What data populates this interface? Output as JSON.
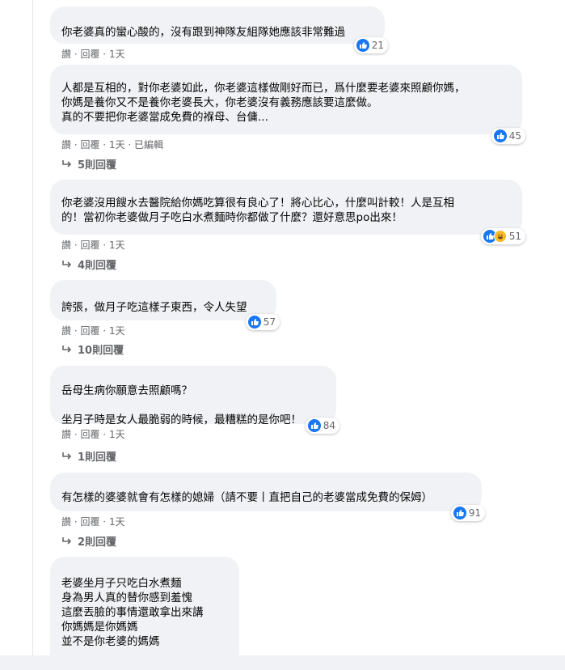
{
  "comments": [
    {
      "text": "你老婆真的蠻心酸的，沒有跟到神隊友組隊她應該非常難過",
      "likes": "21",
      "meta": {
        "like": "讚",
        "reply": "回覆",
        "time": "1天",
        "edited": ""
      }
    },
    {
      "text": "人都是互相的，對你老婆如此，你老婆這樣做剛好而已，爲什麼要老婆來照顧你媽，\n你媽是養你又不是養你老婆長大，你老婆沒有義務應該要這麼做。\n真的不要把你老婆當成免費的褓母、台傭...",
      "likes": "45",
      "meta": {
        "like": "讚",
        "reply": "回覆",
        "time": "1天",
        "edited": "已編輯"
      },
      "replies": "5則回覆"
    },
    {
      "text": "你老婆沒用餿水去醫院給你媽吃算很有良心了！將心比心，什麼叫計較！人是互相\n的！當初你老婆做月子吃白水煮麵時你都做了什麼？還好意思po出來！",
      "likes": "51",
      "meta": {
        "like": "讚",
        "reply": "回覆",
        "time": "1天",
        "edited": ""
      },
      "replies": "4則回覆"
    },
    {
      "text": "誇張，做月子吃這樣子東西，令人失望",
      "likes": "57",
      "meta": {
        "like": "讚",
        "reply": "回覆",
        "time": "1天",
        "edited": ""
      },
      "replies": "10則回覆"
    },
    {
      "text": "岳母生病你願意去照顧嗎？\n\n坐月子時是女人最脆弱的時候，最糟糕的是你吧！",
      "likes": "84",
      "meta": {
        "like": "讚",
        "reply": "回覆",
        "time": "1天",
        "edited": ""
      },
      "replies": "1則回覆"
    },
    {
      "text": "有怎樣的婆婆就會有怎樣的媳婦（請不要丨直把自己的老婆當成免費的保姆）",
      "likes": "91",
      "meta": {
        "like": "讚",
        "reply": "回覆",
        "time": "1天",
        "edited": ""
      },
      "replies": "2則回覆"
    },
    {
      "text": "老婆坐月子只吃白水煮麵\n身為男人真的替你感到羞愧\n這麼丟臉的事情還敢拿出來講\n你媽媽是你媽媽\n並不是你老婆的媽媽"
    }
  ]
}
